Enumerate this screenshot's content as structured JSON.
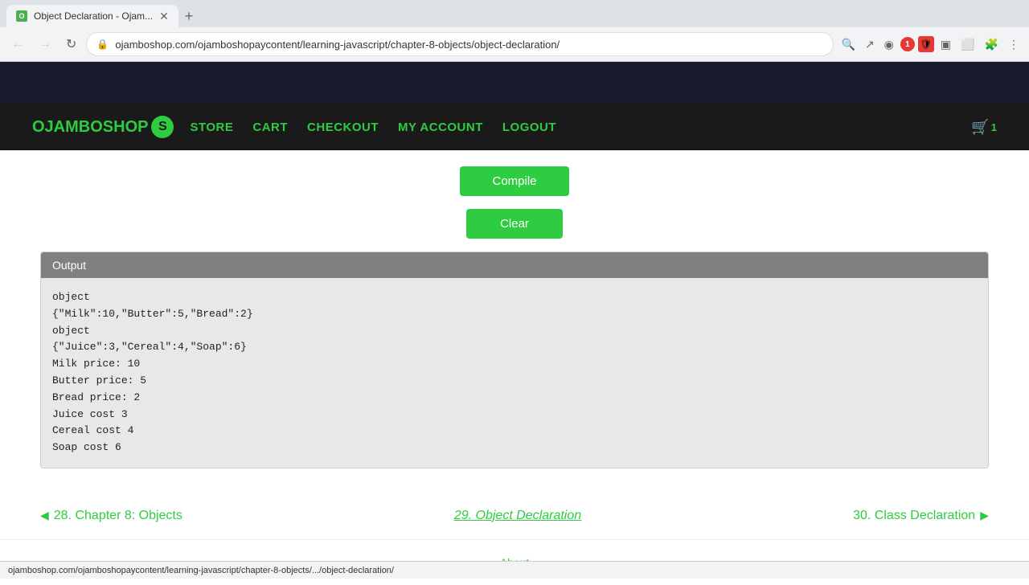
{
  "browser": {
    "tab_title": "Object Declaration - Ojam...",
    "tab_favicon": "O",
    "new_tab_icon": "+",
    "back_btn": "←",
    "forward_btn": "→",
    "refresh_btn": "↻",
    "address": "ojamboshop.com/ojamboshopaycontent/learning-javascript/chapter-8-objects/object-declaration/",
    "status_url": "ojamboshop.com/ojamboshopaycontent/learning-javascript/chapter-8-objects/.../object-declaration/"
  },
  "nav": {
    "logo_text": "OJAMBOSHOP",
    "logo_s": "S",
    "links": [
      {
        "id": "store",
        "label": "STORE"
      },
      {
        "id": "cart",
        "label": "CART"
      },
      {
        "id": "checkout",
        "label": "CHECKOUT"
      },
      {
        "id": "my-account",
        "label": "MY ACCOUNT"
      },
      {
        "id": "logout",
        "label": "LOGOUT"
      }
    ],
    "cart_count": "1"
  },
  "main": {
    "compile_btn": "Compile",
    "clear_btn": "Clear",
    "output_header": "Output",
    "output_lines": [
      "object",
      "{\"Milk\":10,\"Butter\":5,\"Bread\":2}",
      "object",
      "{\"Juice\":3,\"Cereal\":4,\"Soap\":6}",
      "Milk price: 10",
      "Butter price: 5",
      "Bread price: 2",
      "Juice cost 3",
      "Cereal cost 4",
      "Soap cost 6"
    ]
  },
  "pagination": {
    "prev_label": "28. Chapter 8: Objects",
    "prev_arrow": "◀",
    "current_label": "29. Object Declaration",
    "next_label": "30. Class Declaration",
    "next_arrow": "▶"
  },
  "footer": {
    "about_link": "About"
  },
  "colors": {
    "green": "#2ecc40",
    "dark_bg": "#1a1a1a",
    "output_bg": "#e8e8e8",
    "output_header_bg": "#808080"
  }
}
